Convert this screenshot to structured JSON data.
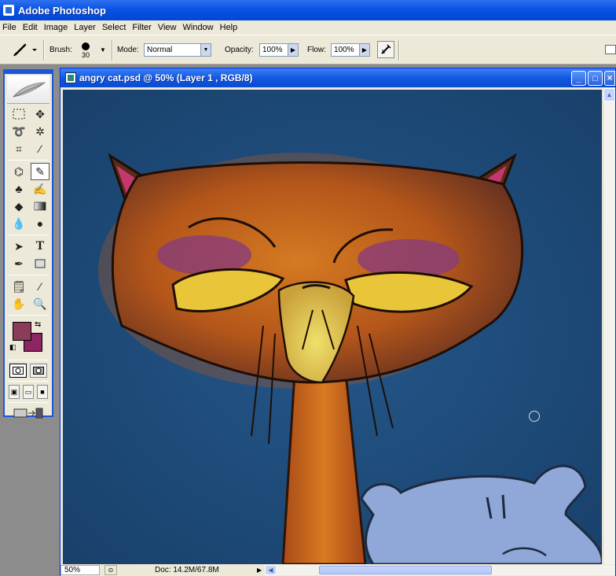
{
  "app": {
    "title": "Adobe Photoshop"
  },
  "menu": [
    "File",
    "Edit",
    "Image",
    "Layer",
    "Select",
    "Filter",
    "View",
    "Window",
    "Help"
  ],
  "options_bar": {
    "brush_label": "Brush:",
    "brush_size": "30",
    "mode_label": "Mode:",
    "mode_value": "Normal",
    "opacity_label": "Opacity:",
    "opacity_value": "100%",
    "flow_label": "Flow:",
    "flow_value": "100%"
  },
  "tools": {
    "foreground_color": "#8b3c5a",
    "background_color": "#8e2563",
    "icons": [
      "marquee-icon",
      "move-icon",
      "lasso-icon",
      "magic-wand-icon",
      "crop-icon",
      "slice-icon",
      "healing-brush-icon",
      "brush-icon",
      "clone-stamp-icon",
      "history-brush-icon",
      "eraser-icon",
      "gradient-icon",
      "blur-icon",
      "dodge-icon",
      "path-select-icon",
      "type-icon",
      "pen-icon",
      "shape-icon",
      "notes-icon",
      "eyedropper-icon",
      "hand-icon",
      "zoom-icon"
    ]
  },
  "document": {
    "title": "angry cat.psd @ 50% (Layer 1 , RGB/8)",
    "zoom": "50%",
    "doc_size": "Doc: 14.2M/67.8M"
  },
  "colors": {
    "xp_blue": "#0a53e3",
    "chrome": "#ece9d8",
    "canvas_bg": "#1d4a78",
    "cat_orange": "#c8661a",
    "cat_ear": "#c4386e",
    "cat_eyes": "#e9c53a",
    "sheep_blue": "#8fa8d8"
  }
}
